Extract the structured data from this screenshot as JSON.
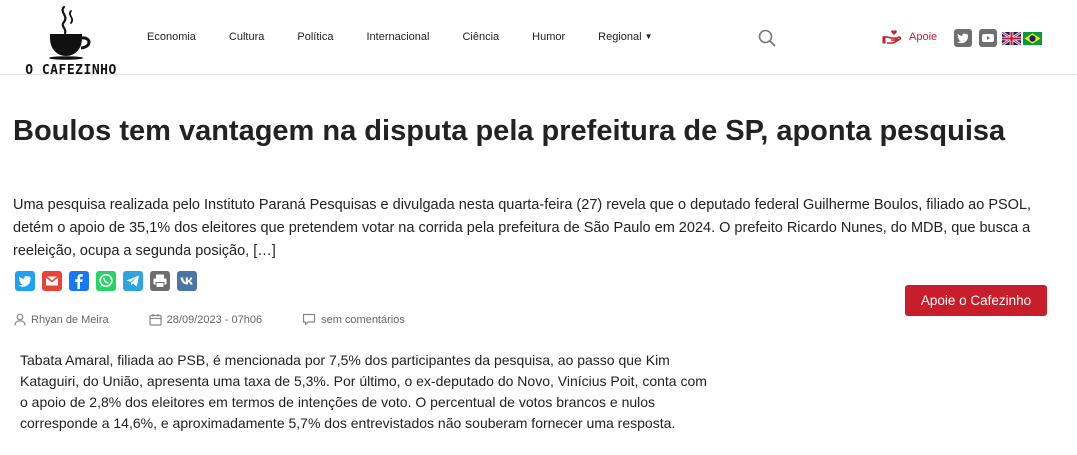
{
  "brand": {
    "logo_text": "O CAFEZINHO"
  },
  "nav": {
    "items": [
      "Economia",
      "Cultura",
      "Política",
      "Internacional",
      "Ciência",
      "Humor",
      "Regional"
    ]
  },
  "header": {
    "apoie_label": "Apoie"
  },
  "article": {
    "title": "Boulos tem vantagem na disputa pela prefeitura de SP, aponta pesquisa",
    "excerpt": "Uma pesquisa realizada pelo Instituto Paraná Pesquisas e divulgada nesta quarta-feira (27) revela que o deputado federal Guilherme Boulos, filiado ao PSOL, detém o apoio de 35,1% dos eleitores que pretendem votar na corrida pela prefeitura de São Paulo em 2024. O prefeito Ricardo Nunes, do MDB, que busca a reeleição, ocupa a segunda posição, […]",
    "author": "Rhyan de Meira",
    "date": "28/09/2023 - 07h06",
    "comments": "sem comentários",
    "support_button": "Apoie o Cafezinho",
    "body": "Tabata Amaral, filiada ao PSB, é mencionada por 7,5% dos participantes da pesquisa, ao passo que Kim Kataguiri, do União, apresenta uma taxa de 5,3%. Por último, o ex-deputado do Novo, Vinícius Poit, conta com o apoio de 2,8% dos eleitores em termos de intenções de voto. O percentual de votos brancos e nulos corresponde a 14,6%, e aproximadamente 5,7% dos entrevistados não souberam fornecer uma resposta."
  },
  "share": {
    "icons": [
      "twitter-icon",
      "gmail-icon",
      "facebook-icon",
      "whatsapp-icon",
      "telegram-icon",
      "print-icon",
      "vk-icon"
    ],
    "colors": {
      "twitter": "#1da1f2",
      "gmail": "#ea4335",
      "facebook": "#1877f2",
      "whatsapp": "#25d366",
      "telegram": "#2ca5e0",
      "print": "#6d6d6d",
      "vk": "#4c75a3"
    }
  },
  "colors": {
    "accent": "#c81e2b",
    "text": "#222222",
    "muted": "#666666"
  }
}
